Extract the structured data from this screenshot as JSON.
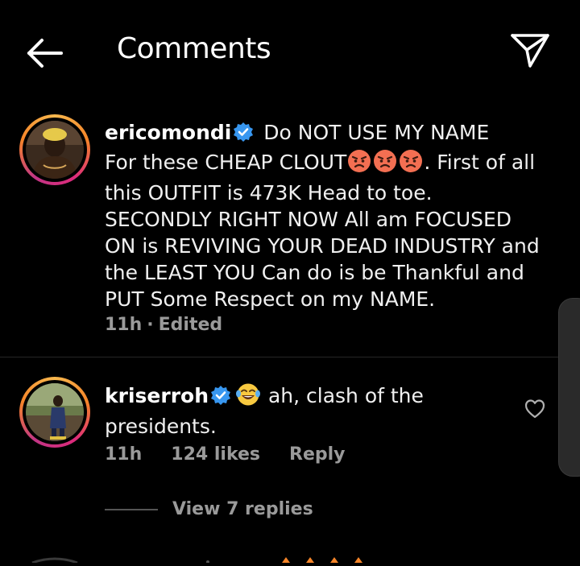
{
  "header": {
    "title": "Comments"
  },
  "comments": [
    {
      "username": "ericomondi",
      "text_before_emoji_line1": "Do NOT USE MY NAME",
      "text_line2_start": "For these CHEAP CLOUT",
      "emoji": "angry-face",
      "emoji_count": 3,
      "text_after_emoji": ". First",
      "text_rest": "of all this OUTFIT is 473K Head to toe. SECONDLY RIGHT NOW All am FOCUSED ON is REVIVING YOUR DEAD INDUSTRY and the LEAST YOU Can do is be Thankful and PUT Some Respect on my NAME.",
      "time": "11h",
      "status": "Edited"
    },
    {
      "username": "kriserroh",
      "emoji": "face-with-tears-of-joy",
      "text": "ah, clash of the presidents.",
      "time": "11h",
      "likes": "124 likes",
      "reply_label": "Reply",
      "view_replies": "View 7 replies"
    }
  ],
  "colors": {
    "background": "#000000",
    "text": "#f5f5f5",
    "meta": "#9a9a9a",
    "verified": "#3897f0",
    "ring_start": "#f8b84e",
    "ring_end": "#dd2a7b"
  },
  "icons": {
    "back": "arrow-left-icon",
    "send": "paper-plane-icon",
    "verified": "verified-badge-icon",
    "heart": "heart-outline-icon"
  }
}
